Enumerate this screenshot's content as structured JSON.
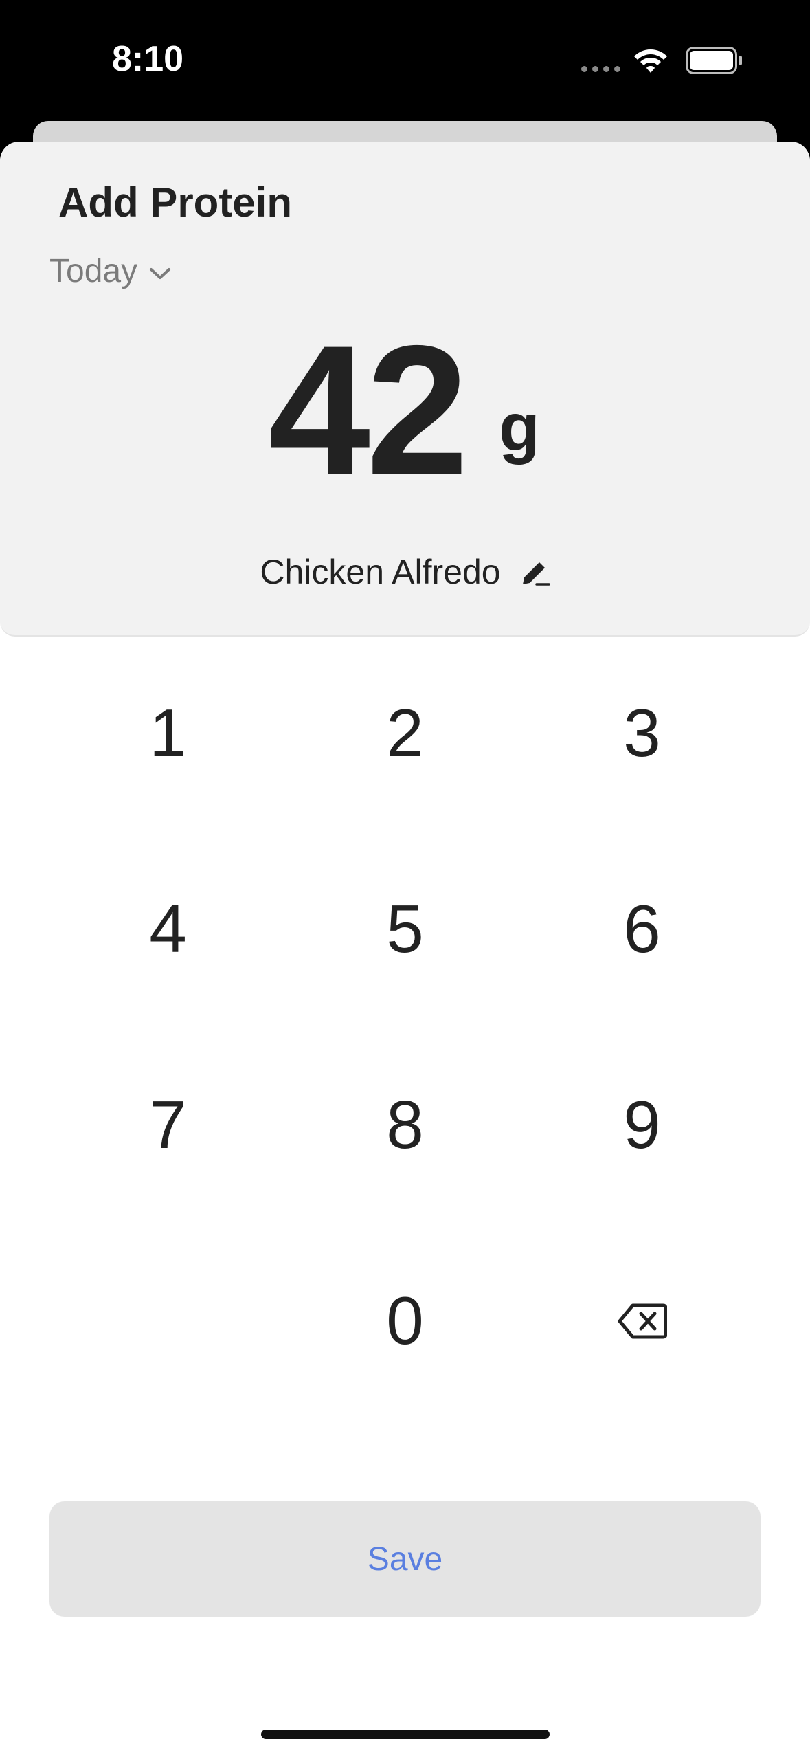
{
  "status_bar": {
    "time": "8:10",
    "icons": [
      "signal-dots-icon",
      "wifi-icon",
      "battery-icon"
    ]
  },
  "sheet": {
    "title": "Add Protein",
    "date_selector": {
      "label": "Today",
      "icon": "chevron-down-icon"
    },
    "amount": {
      "value": "42",
      "unit": "g"
    },
    "food_name": {
      "label": "Chicken Alfredo",
      "icon": "pencil-icon"
    }
  },
  "keypad": {
    "keys": [
      "1",
      "2",
      "3",
      "4",
      "5",
      "6",
      "7",
      "8",
      "9",
      "0"
    ],
    "backspace_icon": "backspace-icon"
  },
  "actions": {
    "save_label": "Save"
  },
  "colors": {
    "background_dark": "#000000",
    "header_panel": "#f2f2f2",
    "text_primary": "#222222",
    "text_secondary": "#7b7b7b",
    "button_background": "#e4e4e4",
    "accent": "#5a7fe0"
  }
}
